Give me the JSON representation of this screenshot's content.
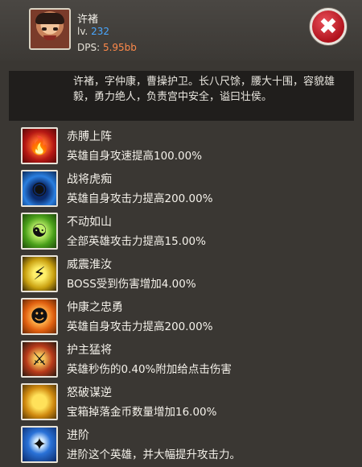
{
  "hero": {
    "name": "许褚",
    "level_label": "lv. ",
    "level_value": "232",
    "dps_label": "DPS: ",
    "dps_value": "5.95bb",
    "description": "许褚，字仲康，曹操护卫。长八尺馀，腰大十围，容貌雄毅，勇力绝人，负责宫中安全，谥曰壮侯。"
  },
  "close_button": {
    "label": "✖",
    "icon": "close-icon"
  },
  "skills": [
    {
      "title": "赤膊上阵",
      "desc": "英雄自身攻速提高100.00%",
      "icon": "flame-warrior-icon",
      "glyph": "🔥"
    },
    {
      "title": "战将虎痴",
      "desc": "英雄自身攻击力提高200.00%",
      "icon": "tiger-face-icon",
      "glyph": "◉"
    },
    {
      "title": "不动如山",
      "desc": "全部英雄攻击力提高15.00%",
      "icon": "mountain-spirit-icon",
      "glyph": "☯"
    },
    {
      "title": "威震淮汝",
      "desc": "BOSS受到伤害增加4.00%",
      "icon": "thunder-mask-icon",
      "glyph": "⚡"
    },
    {
      "title": "仲康之忠勇",
      "desc": "英雄自身攻击力提高200.00%",
      "icon": "beast-face-icon",
      "glyph": "☻"
    },
    {
      "title": "护主猛将",
      "desc": "英雄秒伤的0.40%附加给点击伤害",
      "icon": "guardian-warrior-icon",
      "glyph": "⚔"
    },
    {
      "title": "怒破谋逆",
      "desc": "宝箱掉落金币数量增加16.00%",
      "icon": "treasure-chest-icon",
      "glyph": ""
    },
    {
      "title": "进阶",
      "desc": "进阶这个英雄，并大幅提升攻击力。",
      "icon": "advance-emblem-icon",
      "glyph": "✦"
    }
  ]
}
